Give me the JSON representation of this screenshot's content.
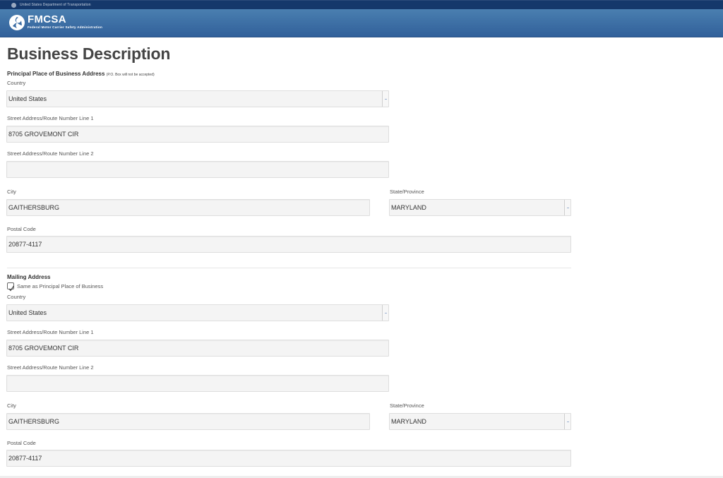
{
  "topbar": {
    "text": "United States Department of Transportation"
  },
  "header": {
    "brand": "FMCSA",
    "subtitle": "Federal Motor Carrier Safety Administration"
  },
  "page_title": "Business Description",
  "principal": {
    "section_title": "Principal Place of Business Address",
    "section_note": "(P.O. Box will not be accepted)",
    "country_label": "Country",
    "country_value": "United States",
    "street1_label": "Street Address/Route Number Line 1",
    "street1_value": "8705 GROVEMONT CIR",
    "street2_label": "Street Address/Route Number Line 2",
    "street2_value": "",
    "city_label": "City",
    "city_value": "GAITHERSBURG",
    "state_label": "State/Province",
    "state_value": "MARYLAND",
    "postal_label": "Postal Code",
    "postal_value": "20877-4117"
  },
  "mailing": {
    "section_title": "Mailing Address",
    "same_as_label": "Same as Principal Place of Business",
    "same_as_checked": true,
    "country_label": "Country",
    "country_value": "United States",
    "street1_label": "Street Address/Route Number Line 1",
    "street1_value": "8705 GROVEMONT CIR",
    "street2_label": "Street Address/Route Number Line 2",
    "street2_value": "",
    "city_label": "City",
    "city_value": "GAITHERSBURG",
    "state_label": "State/Province",
    "state_value": "MARYLAND",
    "postal_label": "Postal Code",
    "postal_value": "20877-4117"
  },
  "colors": {
    "topbar": "#15386b",
    "header_top": "#4a7fb0",
    "header_bottom": "#31609a",
    "field_bg": "#f4f4f4"
  }
}
